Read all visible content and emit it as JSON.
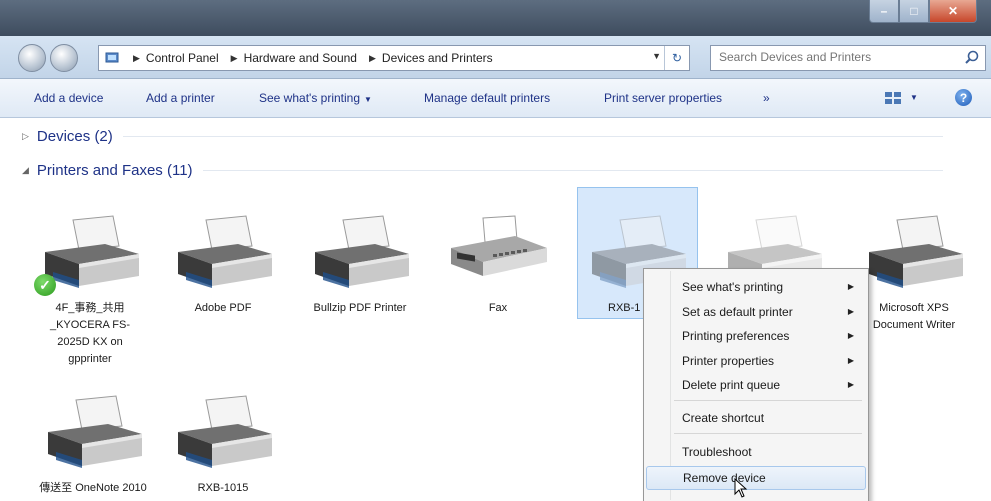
{
  "window": {
    "controls": [
      "–",
      "□",
      "✕"
    ]
  },
  "address_bar": {
    "crumbs": [
      "Control Panel",
      "Hardware and Sound",
      "Devices and Printers"
    ]
  },
  "search": {
    "placeholder": "Search Devices and Printers"
  },
  "command_bar": {
    "add_device": "Add a device",
    "add_printer": "Add a printer",
    "see_whats_printing": "See what's printing",
    "manage_default": "Manage default printers",
    "print_server": "Print server properties",
    "more": "»"
  },
  "groups": {
    "devices": "Devices (2)",
    "printers": "Printers and Faxes (11)"
  },
  "printers": [
    {
      "label": "4F_事務_共用_KYOCERA FS-2025D KX on gpprinter",
      "icon": "printer-icon",
      "default": true
    },
    {
      "label": "Adobe PDF",
      "icon": "printer-icon"
    },
    {
      "label": "Bullzip PDF Printer",
      "icon": "printer-icon"
    },
    {
      "label": "Fax",
      "icon": "fax-icon"
    },
    {
      "label": "RXB-1",
      "icon": "printer-icon",
      "selected": true
    },
    {
      "label": "",
      "icon": "printer-icon"
    },
    {
      "label": "Microsoft XPS Document Writer",
      "icon": "printer-icon"
    },
    {
      "label": "傳送至 OneNote 2010",
      "icon": "printer-icon"
    },
    {
      "label": "RXB-1015",
      "icon": "printer-icon"
    }
  ],
  "context_menu": {
    "items": [
      {
        "label": "See what's printing",
        "submenu": true
      },
      {
        "label": "Set as default printer",
        "submenu": true
      },
      {
        "label": "Printing preferences",
        "submenu": true
      },
      {
        "label": "Printer properties",
        "submenu": true
      },
      {
        "label": "Delete print queue",
        "submenu": true
      },
      {
        "label": "Create shortcut",
        "submenu": false
      },
      {
        "label": "Troubleshoot",
        "submenu": false
      },
      {
        "label": "Remove device",
        "submenu": false,
        "hovered": true
      }
    ]
  },
  "colors": {
    "link_text": "#1e3287",
    "selection": "#d7e8fb",
    "titlebar": "#3e4c5e"
  }
}
